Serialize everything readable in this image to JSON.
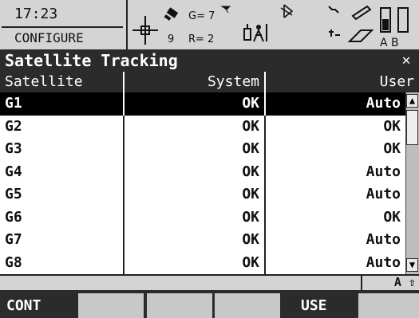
{
  "status": {
    "time": "17:23",
    "mode": "CONFIGURE",
    "glonass_label": "G= 7",
    "gps_count": "9",
    "rtk_label": "R= 2",
    "interface_letters": "A B"
  },
  "window": {
    "title": "Satellite Tracking",
    "close_glyph": "✕"
  },
  "table": {
    "headers": [
      "Satellite",
      "System",
      "User"
    ],
    "rows": [
      {
        "sat": "G1",
        "system": "OK",
        "user": "Auto",
        "selected": true
      },
      {
        "sat": "G2",
        "system": "OK",
        "user": "OK"
      },
      {
        "sat": "G3",
        "system": "OK",
        "user": "OK"
      },
      {
        "sat": "G4",
        "system": "OK",
        "user": "Auto"
      },
      {
        "sat": "G5",
        "system": "OK",
        "user": "Auto"
      },
      {
        "sat": "G6",
        "system": "OK",
        "user": "OK"
      },
      {
        "sat": "G7",
        "system": "OK",
        "user": "Auto"
      },
      {
        "sat": "G8",
        "system": "OK",
        "user": "Auto"
      }
    ]
  },
  "footer": {
    "caps_label": "A ⇧"
  },
  "fkeys": [
    "CONT",
    "",
    "",
    "",
    "USE",
    ""
  ],
  "scroll": {
    "up_glyph": "▲",
    "down_glyph": "▼"
  }
}
